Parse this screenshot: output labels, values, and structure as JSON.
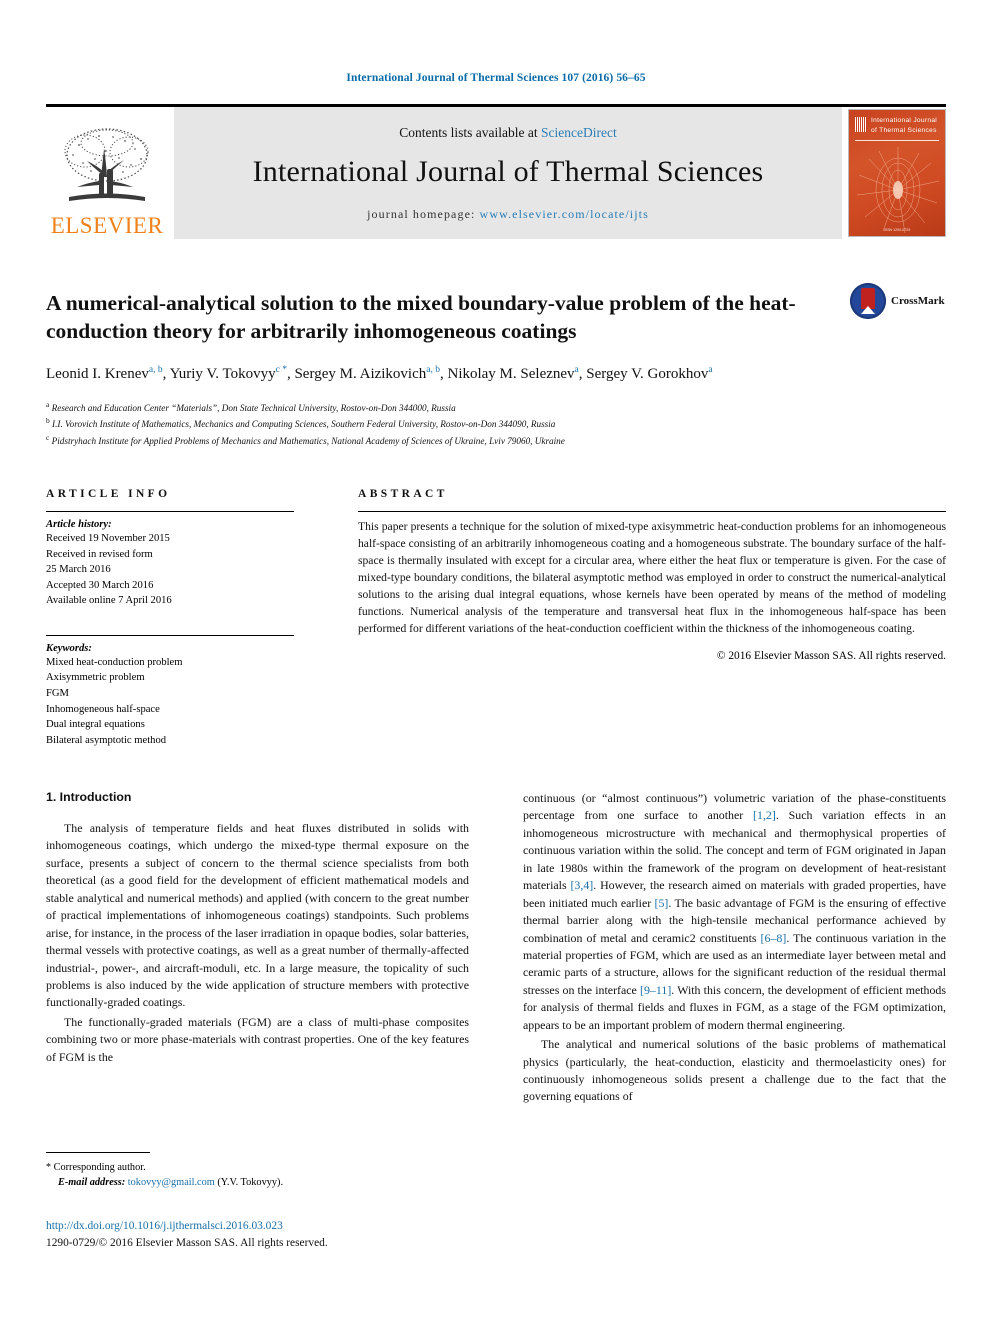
{
  "running_head": "International Journal of Thermal Sciences 107 (2016) 56–65",
  "masthead": {
    "contents_prefix": "Contents lists available at ",
    "sciencedirect": "ScienceDirect",
    "journal_title": "International Journal of Thermal Sciences",
    "homepage_label": "journal homepage: ",
    "homepage_url": "www.elsevier.com/locate/ijts",
    "publisher_wordmark": "ELSEVIER",
    "cover_title": "International Journal of Thermal Sciences",
    "cover_footer": "ISSN 1290-0729"
  },
  "article": {
    "title": "A numerical-analytical solution to the mixed boundary-value problem of the heat-conduction theory for arbitrarily inhomogeneous coatings",
    "crossmark_label": "CrossMark",
    "authors": [
      {
        "name": "Leonid I. Krenev",
        "sup": "a, b",
        "star": false
      },
      {
        "name": "Yuriy V. Tokovyy",
        "sup": "c",
        "star": true
      },
      {
        "name": "Sergey M. Aizikovich",
        "sup": "a, b",
        "star": false
      },
      {
        "name": "Nikolay M. Seleznev",
        "sup": "a",
        "star": false
      },
      {
        "name": "Sergey V. Gorokhov",
        "sup": "a",
        "star": false
      }
    ],
    "affiliations": [
      {
        "marker": "a",
        "text": "Research and Education Center “Materials”, Don State Technical University, Rostov-on-Don 344000, Russia"
      },
      {
        "marker": "b",
        "text": "I.I. Vorovich Institute of Mathematics, Mechanics and Computing Sciences, Southern Federal University, Rostov-on-Don 344090, Russia"
      },
      {
        "marker": "c",
        "text": "Pidstryhach Institute for Applied Problems of Mechanics and Mathematics, National Academy of Sciences of Ukraine, Lviv 79060, Ukraine"
      }
    ]
  },
  "article_info": {
    "heading": "ARTICLE INFO",
    "history_label": "Article history:",
    "history": [
      "Received 19 November 2015",
      "Received in revised form",
      "25 March 2016",
      "Accepted 30 March 2016",
      "Available online 7 April 2016"
    ],
    "keywords_label": "Keywords:",
    "keywords": [
      "Mixed heat-conduction problem",
      "Axisymmetric problem",
      "FGM",
      "Inhomogeneous half-space",
      "Dual integral equations",
      "Bilateral asymptotic method"
    ]
  },
  "abstract": {
    "heading": "ABSTRACT",
    "text": "This paper presents a technique for the solution of mixed-type axisymmetric heat-conduction problems for an inhomogeneous half-space consisting of an arbitrarily inhomogeneous coating and a homogeneous substrate. The boundary surface of the half-space is thermally insulated with except for a circular area, where either the heat flux or temperature is given. For the case of mixed-type boundary conditions, the bilateral asymptotic method was employed in order to construct the numerical-analytical solutions to the arising dual integral equations, whose kernels have been operated by means of the method of modeling functions. Numerical analysis of the temperature and transversal heat flux in the inhomogeneous half-space has been performed for different variations of the heat-conduction coefficient within the thickness of the inhomogeneous coating.",
    "copyright": "© 2016 Elsevier Masson SAS. All rights reserved."
  },
  "body": {
    "section_title": "1. Introduction",
    "left_paragraphs": [
      "The analysis of temperature fields and heat fluxes distributed in solids with inhomogeneous coatings, which undergo the mixed-type thermal exposure on the surface, presents a subject of concern to the thermal science specialists from both theoretical (as a good field for the development of efficient mathematical models and stable analytical and numerical methods) and applied (with concern to the great number of practical implementations of inhomogeneous coatings) standpoints. Such problems arise, for instance, in the process of the laser irradiation in opaque bodies, solar batteries, thermal vessels with protective coatings, as well as a great number of thermally-affected industrial-, power-, and aircraft-moduli, etc. In a large measure, the topicality of such problems is also induced by the wide application of structure members with protective functionally-graded coatings.",
      "The functionally-graded materials (FGM) are a class of multi-phase composites combining two or more phase-materials with contrast properties. One of the key features of FGM is the"
    ],
    "right_paragraphs": [
      {
        "indent": false,
        "parts": [
          {
            "t": "continuous (or “almost continuous”) volumetric variation of the phase-constituents percentage from one surface to another ",
            "cite": false
          },
          {
            "t": "[1,2]",
            "cite": true
          },
          {
            "t": ". Such variation effects in an inhomogeneous microstructure with mechanical and thermophysical properties of continuous variation within the solid. The concept and term of FGM originated in Japan in late 1980s within the framework of the program on development of heat-resistant materials ",
            "cite": false
          },
          {
            "t": "[3,4]",
            "cite": true
          },
          {
            "t": ". However, the research aimed on materials with graded properties, have been initiated much earlier ",
            "cite": false
          },
          {
            "t": "[5]",
            "cite": true
          },
          {
            "t": ". The basic advantage of FGM is the ensuring of effective thermal barrier along with the high-tensile mechanical performance achieved by combination of metal and ceramic2 constituents ",
            "cite": false
          },
          {
            "t": "[6–8]",
            "cite": true
          },
          {
            "t": ". The continuous variation in the material properties of FGM, which are used as an intermediate layer between metal and ceramic parts of a structure, allows for the significant reduction of the residual thermal stresses on the interface ",
            "cite": false
          },
          {
            "t": "[9–11]",
            "cite": true
          },
          {
            "t": ". With this concern, the development of efficient methods for analysis of thermal fields and fluxes in FGM, as a stage of the FGM optimization, appears to be an important problem of modern thermal engineering.",
            "cite": false
          }
        ]
      },
      {
        "indent": true,
        "parts": [
          {
            "t": "The analytical and numerical solutions of the basic problems of mathematical physics (particularly, the heat-conduction, elasticity and thermoelasticity ones) for continuously inhomogeneous solids present a challenge due to the fact that the governing equations of",
            "cite": false
          }
        ]
      }
    ]
  },
  "footnote": {
    "star": "*",
    "corresponding": "Corresponding author.",
    "email_label": "E-mail address:",
    "email": "tokovyy@gmail.com",
    "email_owner": "(Y.V. Tokovyy)."
  },
  "footer": {
    "doi": "http://dx.doi.org/10.1016/j.ijthermalsci.2016.03.023",
    "issn_line": "1290-0729/© 2016 Elsevier Masson SAS. All rights reserved."
  },
  "colors": {
    "link": "#1a6fa8",
    "elsevier_orange": "#f0811a",
    "cover_red": "#c8421f"
  }
}
